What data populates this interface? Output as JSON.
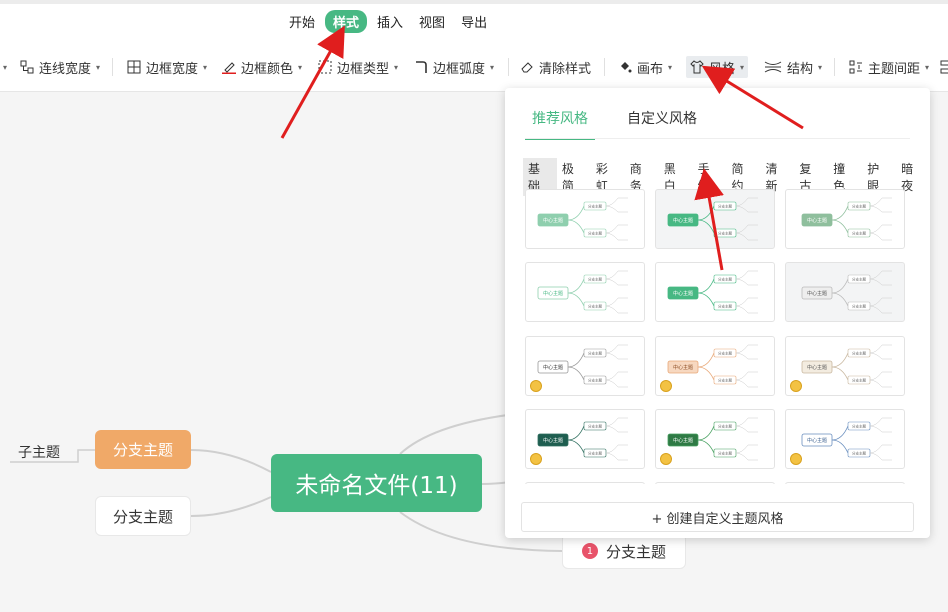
{
  "menu": {
    "items": [
      {
        "label": "开始"
      },
      {
        "label": "样式",
        "active": true
      },
      {
        "label": "插入"
      },
      {
        "label": "视图"
      },
      {
        "label": "导出"
      }
    ]
  },
  "toolbar": {
    "line_width": "连线宽度",
    "border_width": "边框宽度",
    "border_color": "边框颜色",
    "border_type": "边框类型",
    "border_radius": "边框弧度",
    "clear_style": "清除样式",
    "canvas": "画布",
    "style": "风格",
    "structure": "结构",
    "topic_spacing": "主题间距"
  },
  "canvas": {
    "center": "未命名文件(11)",
    "branch_orange": "分支主题",
    "branch_white": "分支主题",
    "branch_bottom": "分支主题",
    "branch_bottom_badge": "1",
    "subtopic": "子主题"
  },
  "panel": {
    "tabs": [
      "推荐风格",
      "自定义风格"
    ],
    "categories": [
      "基础",
      "极简",
      "彩虹",
      "商务",
      "黑白",
      "手绘",
      "简约",
      "清新",
      "复古",
      "撞色",
      "护眼",
      "暗夜"
    ],
    "create_button": "+ 创建自定义主题风格",
    "thumb_center": "中心主题",
    "thumb_branch": "分支主题"
  },
  "colors": {
    "accent": "#47b883",
    "orange": "#f0a968",
    "arrow": "#e01e1e"
  }
}
